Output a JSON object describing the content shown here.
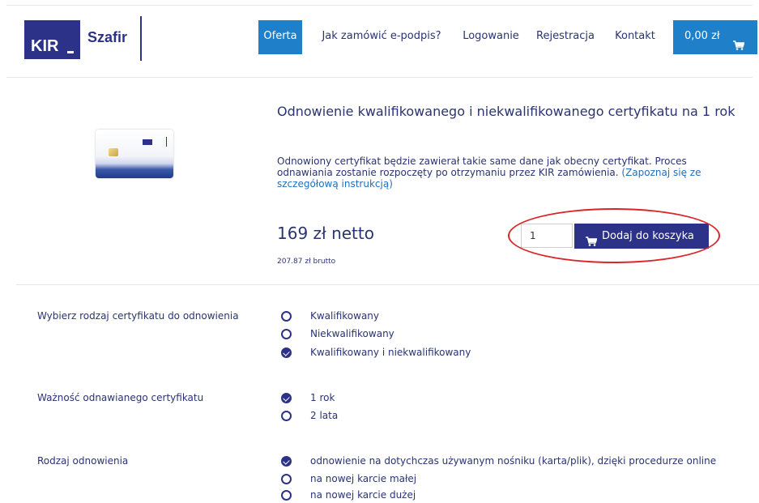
{
  "header": {
    "logo_kir": "KIR",
    "logo_szafir": "Szafir",
    "nav": [
      "Oferta",
      "Jak zamówić e-podpis?",
      "Logowanie",
      "Rejestracja",
      "Kontakt"
    ],
    "cart_amount": "0,00 zł",
    "cart_icon": "cart-icon"
  },
  "product": {
    "title": "Odnowienie kwalifikowanego i niekwalifikowanego certyfikatu na 1 rok",
    "description": "Odnowiony certyfikat będzie zawierał takie same dane jak obecny certyfikat. Proces odnawiania zostanie rozpoczęty po otrzymaniu przez KIR zamówienia.",
    "description_link": "(Zapoznaj się ze szczegółową instrukcją)",
    "price_net": "169 zł netto",
    "price_gross": "207.87 zł brutto",
    "quantity": "1",
    "add_to_cart": "Dodaj do koszyka"
  },
  "options": {
    "type": {
      "label": "Wybierz rodzaj certyfikatu do odnowienia",
      "items": [
        "Kwalifikowany",
        "Niekwalifikowany",
        "Kwalifikowany i niekwalifikowany"
      ],
      "selected": 2
    },
    "validity": {
      "label": "Ważność odnawianego certyfikatu",
      "items": [
        "1 rok",
        "2 lata"
      ],
      "selected": 0
    },
    "renewal": {
      "label": "Rodzaj odnowienia",
      "items": [
        "odnowienie na dotychczas używanym nośniku (karta/plik), dzięki procedurze online",
        "na nowej karcie małej",
        "na nowej karcie dużej"
      ],
      "selected": 0
    }
  },
  "colors": {
    "brand": "#2b3288",
    "accent": "#1f7fc8",
    "highlight": "#d8262b"
  }
}
